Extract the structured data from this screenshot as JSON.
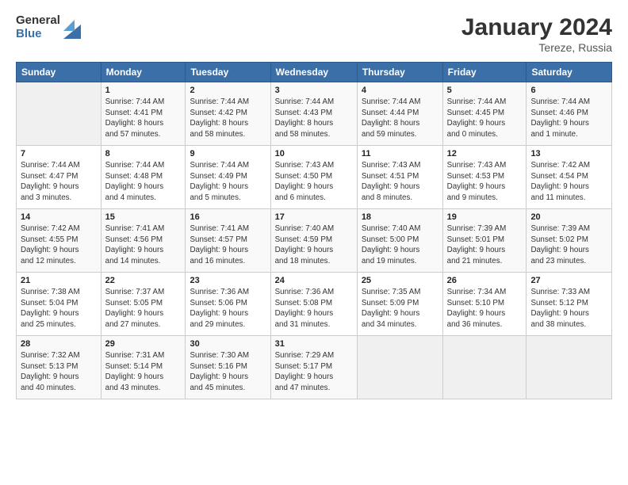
{
  "logo": {
    "general": "General",
    "blue": "Blue"
  },
  "title": "January 2024",
  "location": "Tereze, Russia",
  "headers": [
    "Sunday",
    "Monday",
    "Tuesday",
    "Wednesday",
    "Thursday",
    "Friday",
    "Saturday"
  ],
  "weeks": [
    [
      {
        "day": "",
        "info": ""
      },
      {
        "day": "1",
        "info": "Sunrise: 7:44 AM\nSunset: 4:41 PM\nDaylight: 8 hours\nand 57 minutes."
      },
      {
        "day": "2",
        "info": "Sunrise: 7:44 AM\nSunset: 4:42 PM\nDaylight: 8 hours\nand 58 minutes."
      },
      {
        "day": "3",
        "info": "Sunrise: 7:44 AM\nSunset: 4:43 PM\nDaylight: 8 hours\nand 58 minutes."
      },
      {
        "day": "4",
        "info": "Sunrise: 7:44 AM\nSunset: 4:44 PM\nDaylight: 8 hours\nand 59 minutes."
      },
      {
        "day": "5",
        "info": "Sunrise: 7:44 AM\nSunset: 4:45 PM\nDaylight: 9 hours\nand 0 minutes."
      },
      {
        "day": "6",
        "info": "Sunrise: 7:44 AM\nSunset: 4:46 PM\nDaylight: 9 hours\nand 1 minute."
      }
    ],
    [
      {
        "day": "7",
        "info": "Sunrise: 7:44 AM\nSunset: 4:47 PM\nDaylight: 9 hours\nand 3 minutes."
      },
      {
        "day": "8",
        "info": "Sunrise: 7:44 AM\nSunset: 4:48 PM\nDaylight: 9 hours\nand 4 minutes."
      },
      {
        "day": "9",
        "info": "Sunrise: 7:44 AM\nSunset: 4:49 PM\nDaylight: 9 hours\nand 5 minutes."
      },
      {
        "day": "10",
        "info": "Sunrise: 7:43 AM\nSunset: 4:50 PM\nDaylight: 9 hours\nand 6 minutes."
      },
      {
        "day": "11",
        "info": "Sunrise: 7:43 AM\nSunset: 4:51 PM\nDaylight: 9 hours\nand 8 minutes."
      },
      {
        "day": "12",
        "info": "Sunrise: 7:43 AM\nSunset: 4:53 PM\nDaylight: 9 hours\nand 9 minutes."
      },
      {
        "day": "13",
        "info": "Sunrise: 7:42 AM\nSunset: 4:54 PM\nDaylight: 9 hours\nand 11 minutes."
      }
    ],
    [
      {
        "day": "14",
        "info": "Sunrise: 7:42 AM\nSunset: 4:55 PM\nDaylight: 9 hours\nand 12 minutes."
      },
      {
        "day": "15",
        "info": "Sunrise: 7:41 AM\nSunset: 4:56 PM\nDaylight: 9 hours\nand 14 minutes."
      },
      {
        "day": "16",
        "info": "Sunrise: 7:41 AM\nSunset: 4:57 PM\nDaylight: 9 hours\nand 16 minutes."
      },
      {
        "day": "17",
        "info": "Sunrise: 7:40 AM\nSunset: 4:59 PM\nDaylight: 9 hours\nand 18 minutes."
      },
      {
        "day": "18",
        "info": "Sunrise: 7:40 AM\nSunset: 5:00 PM\nDaylight: 9 hours\nand 19 minutes."
      },
      {
        "day": "19",
        "info": "Sunrise: 7:39 AM\nSunset: 5:01 PM\nDaylight: 9 hours\nand 21 minutes."
      },
      {
        "day": "20",
        "info": "Sunrise: 7:39 AM\nSunset: 5:02 PM\nDaylight: 9 hours\nand 23 minutes."
      }
    ],
    [
      {
        "day": "21",
        "info": "Sunrise: 7:38 AM\nSunset: 5:04 PM\nDaylight: 9 hours\nand 25 minutes."
      },
      {
        "day": "22",
        "info": "Sunrise: 7:37 AM\nSunset: 5:05 PM\nDaylight: 9 hours\nand 27 minutes."
      },
      {
        "day": "23",
        "info": "Sunrise: 7:36 AM\nSunset: 5:06 PM\nDaylight: 9 hours\nand 29 minutes."
      },
      {
        "day": "24",
        "info": "Sunrise: 7:36 AM\nSunset: 5:08 PM\nDaylight: 9 hours\nand 31 minutes."
      },
      {
        "day": "25",
        "info": "Sunrise: 7:35 AM\nSunset: 5:09 PM\nDaylight: 9 hours\nand 34 minutes."
      },
      {
        "day": "26",
        "info": "Sunrise: 7:34 AM\nSunset: 5:10 PM\nDaylight: 9 hours\nand 36 minutes."
      },
      {
        "day": "27",
        "info": "Sunrise: 7:33 AM\nSunset: 5:12 PM\nDaylight: 9 hours\nand 38 minutes."
      }
    ],
    [
      {
        "day": "28",
        "info": "Sunrise: 7:32 AM\nSunset: 5:13 PM\nDaylight: 9 hours\nand 40 minutes."
      },
      {
        "day": "29",
        "info": "Sunrise: 7:31 AM\nSunset: 5:14 PM\nDaylight: 9 hours\nand 43 minutes."
      },
      {
        "day": "30",
        "info": "Sunrise: 7:30 AM\nSunset: 5:16 PM\nDaylight: 9 hours\nand 45 minutes."
      },
      {
        "day": "31",
        "info": "Sunrise: 7:29 AM\nSunset: 5:17 PM\nDaylight: 9 hours\nand 47 minutes."
      },
      {
        "day": "",
        "info": ""
      },
      {
        "day": "",
        "info": ""
      },
      {
        "day": "",
        "info": ""
      }
    ]
  ]
}
